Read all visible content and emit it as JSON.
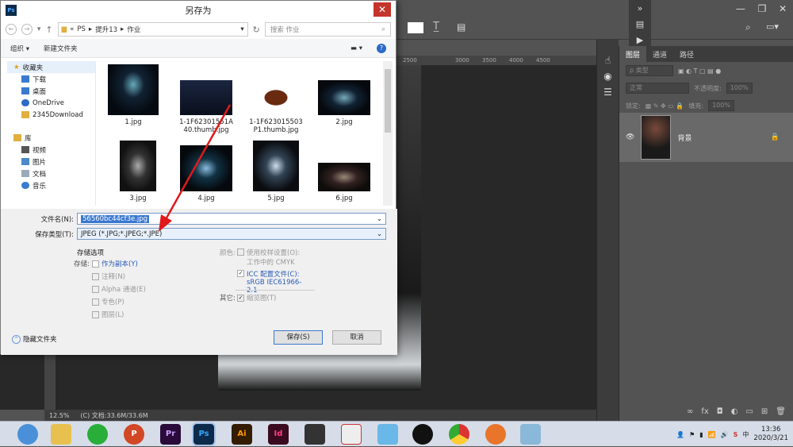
{
  "photoshop": {
    "win_controls": [
      "—",
      "❐",
      "✕"
    ],
    "ruler_marks": [
      "2500",
      "3000",
      "3500",
      "4000",
      "4500"
    ],
    "status": {
      "zoom": "12.5%",
      "doc": "(C) 文档:33.6M/33.6M"
    },
    "panel_tabs": [
      "图层",
      "通道",
      "路径"
    ],
    "kind_label": "ρ 类型",
    "blend_mode": "正常",
    "opacity_label": "不透明度:",
    "opacity_value": "100%",
    "lock_label": "锁定:",
    "fill_label": "填充:",
    "fill_value": "100%",
    "layer_name": "背景",
    "footer_icons": [
      "∞",
      "fx",
      "◘",
      "◐",
      "▭",
      "⊞",
      "🗑"
    ]
  },
  "dialog": {
    "title": "另存为",
    "app_icon": "Ps",
    "close": "✕",
    "breadcrumb": [
      "«",
      "PS",
      "提升13",
      "作业"
    ],
    "search_placeholder": "搜索 作业",
    "toolbar": {
      "organize": "组织 ▾",
      "new_folder": "新建文件夹"
    },
    "nav": {
      "favorites_label": "收藏夹",
      "favorites": [
        "下载",
        "桌面",
        "OneDrive",
        "2345Download"
      ],
      "library_label": "库",
      "library": [
        "视频",
        "图片",
        "文档",
        "音乐"
      ]
    },
    "files": [
      {
        "name": "1.jpg"
      },
      {
        "name": "1-1F62301551A 40.thumb.jpg"
      },
      {
        "name": "1-1F623015503 P1.thumb.jpg"
      },
      {
        "name": "2.jpg"
      },
      {
        "name": "3.jpg"
      },
      {
        "name": "4.jpg"
      },
      {
        "name": "5.jpg"
      },
      {
        "name": "6.jpg"
      }
    ],
    "filename_label": "文件名(N):",
    "filename_value": "56560bc44cf3e.jpg",
    "filetype_label": "保存类型(T):",
    "filetype_value": "JPEG (*.JPG;*.JPEG;*.JPE)",
    "options": {
      "section_title": "存储选项",
      "store_label": "存储:",
      "as_copy": "作为副本(Y)",
      "annotations": "注释(N)",
      "alpha": "Alpha 通道(E)",
      "spot": "专色(P)",
      "layers": "图层(L)",
      "color_label": "颜色:",
      "proof": "使用校样设置(O): 工作中的 CMYK",
      "icc": "ICC 配置文件(C): sRGB IEC61966-2.1",
      "other_label": "其它:",
      "thumbnail": "缩览图(T)"
    },
    "hide_folders": "隐藏文件夹",
    "save_button": "保存(S)",
    "cancel_button": "取消"
  },
  "taskbar": {
    "apps": [
      "IE",
      "文件",
      "微信",
      "P",
      "Pr",
      "Ps",
      "Ai",
      "Id",
      "视频",
      "图",
      "鸟",
      "QQ",
      "Chrome",
      "鱼",
      "盒"
    ],
    "time": "13:36",
    "date": "2020/3/21"
  },
  "colors": {
    "ps_blue": "#31a8ff",
    "save_border": "#3a78d0",
    "arrow": "#e0191a"
  }
}
